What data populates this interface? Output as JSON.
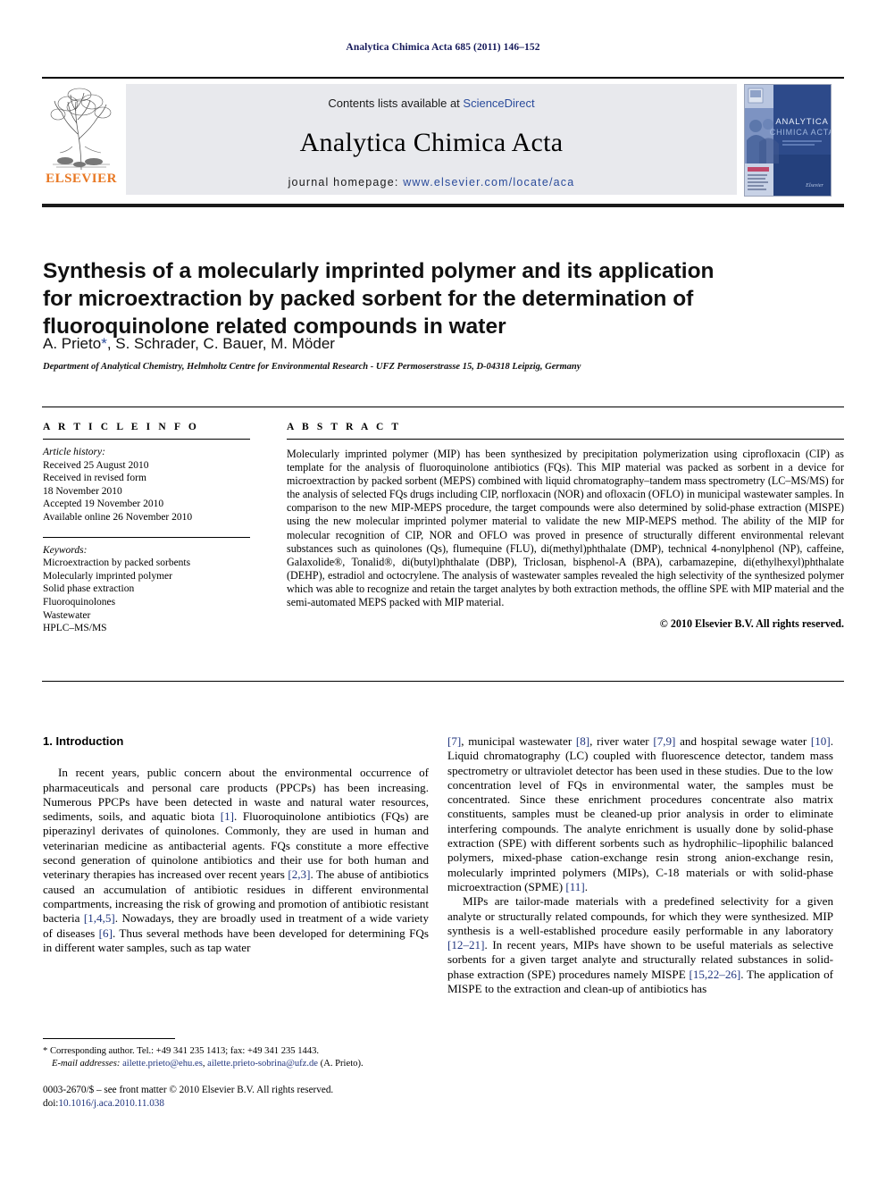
{
  "running_head": "Analytica Chimica Acta 685 (2011) 146–152",
  "masthead": {
    "contents_prefix": "Contents lists available at ",
    "sciencedirect": "ScienceDirect",
    "journal_title": "Analytica Chimica Acta",
    "homepage_prefix": "journal homepage: ",
    "homepage_url": "www.elsevier.com/locate/aca",
    "publisher": "ELSEVIER",
    "cover_title_line1": "ANALYTICA",
    "cover_title_line2": "CHIMICA ACTA",
    "link_color": "#2a4b9b",
    "publisher_color": "#e87722"
  },
  "article": {
    "title": "Synthesis of a molecularly imprinted polymer and its application for microextraction by packed sorbent for the determination of fluoroquinolone related compounds in water",
    "authors": "A. Prieto",
    "authors_rest": ", S. Schrader, C. Bauer, M. Möder",
    "corresponding_marker": "*",
    "affiliation": "Department of Analytical Chemistry, Helmholtz Centre for Environmental Research - UFZ Permoserstrasse 15, D-04318 Leipzig, Germany"
  },
  "article_info": {
    "label": "A R T I C L E   I N F O",
    "history_label": "Article history:",
    "history": [
      "Received 25 August 2010",
      "Received in revised form",
      "18 November 2010",
      "Accepted 19 November 2010",
      "Available online 26 November 2010"
    ],
    "keywords_label": "Keywords:",
    "keywords": [
      "Microextraction by packed sorbents",
      "Molecularly imprinted polymer",
      "Solid phase extraction",
      "Fluoroquinolones",
      "Wastewater",
      "HPLC–MS/MS"
    ]
  },
  "abstract": {
    "label": "A B S T R A C T",
    "text": "Molecularly imprinted polymer (MIP) has been synthesized by precipitation polymerization using ciprofloxacin (CIP) as template for the analysis of fluoroquinolone antibiotics (FQs). This MIP material was packed as sorbent in a device for microextraction by packed sorbent (MEPS) combined with liquid chromatography–tandem mass spectrometry (LC–MS/MS) for the analysis of selected FQs drugs including CIP, norfloxacin (NOR) and ofloxacin (OFLO) in municipal wastewater samples. In comparison to the new MIP-MEPS procedure, the target compounds were also determined by solid-phase extraction (MISPE) using the new molecular imprinted polymer material to validate the new MIP-MEPS method. The ability of the MIP for molecular recognition of CIP, NOR and OFLO was proved in presence of structurally different environmental relevant substances such as quinolones (Qs), flumequine (FLU), di(methyl)phthalate (DMP), technical 4-nonylphenol (NP), caffeine, Galaxolide®, Tonalid®, di(butyl)phthalate (DBP), Triclosan, bisphenol-A (BPA), carbamazepine, di(ethylhexyl)phthalate (DEHP), estradiol and octocrylene. The analysis of wastewater samples revealed the high selectivity of the synthesized polymer which was able to recognize and retain the target analytes by both extraction methods, the offline SPE with MIP material and the semi-automated MEPS packed with MIP material.",
    "copyright": "© 2010 Elsevier B.V. All rights reserved."
  },
  "introduction": {
    "heading": "1. Introduction",
    "left_para_1_a": "In recent years, public concern about the environmental occurrence of pharmaceuticals and personal care products (PPCPs) has been increasing. Numerous PPCPs have been detected in waste and natural water resources, sediments, soils, and aquatic biota ",
    "cite_1": "[1]",
    "left_para_1_b": ". Fluoroquinolone antibiotics (FQs) are piperazinyl derivates of quinolones. Commonly, they are used in human and veterinarian medicine as antibacterial agents. FQs constitute a more effective second generation of quinolone antibiotics and their use for both human and veterinary therapies has increased over recent years ",
    "cite_2_3": "[2,3]",
    "left_para_1_c": ". The abuse of antibiotics caused an accumulation of antibiotic residues in different environmental compartments, increasing the risk of growing and promotion of antibiotic resistant bacteria ",
    "cite_1_4_5": "[1,4,5]",
    "left_para_1_d": ". Nowadays, they are broadly used in treatment of a wide variety of diseases ",
    "cite_6": "[6]",
    "left_para_1_e": ". Thus several methods have been developed for determining FQs in different water samples, such as tap water ",
    "right_cite_7": "[7]",
    "right_a": ", municipal wastewater ",
    "right_cite_8": "[8]",
    "right_b": ", river water ",
    "right_cite_7_9": "[7,9]",
    "right_c": " and hospital sewage water ",
    "right_cite_10": "[10]",
    "right_d": ". Liquid chromatography (LC) coupled with fluorescence detector, tandem mass spectrometry or ultraviolet detector has been used in these studies. Due to the low concentration level of FQs in environmental water, the samples must be concentrated. Since these enrichment procedures concentrate also matrix constituents, samples must be cleaned-up prior analysis in order to eliminate interfering compounds. The analyte enrichment is usually done by solid-phase extraction (SPE) with different sorbents such as hydrophilic–lipophilic balanced polymers, mixed-phase cation-exchange resin strong anion-exchange resin, molecularly imprinted polymers (MIPs), C-18 materials or with solid-phase microextraction (SPME) ",
    "right_cite_11": "[11]",
    "right_e": ".",
    "right_para_2_a": "MIPs are tailor-made materials with a predefined selectivity for a given analyte or structurally related compounds, for which they were synthesized. MIP synthesis is a well-established procedure easily performable in any laboratory ",
    "right_cite_12_21": "[12–21]",
    "right_para_2_b": ". In recent years, MIPs have shown to be useful materials as selective sorbents for a given target analyte and structurally related substances in solid-phase extraction (SPE) procedures namely MISPE ",
    "right_cite_15_22_26": "[15,22–26]",
    "right_para_2_c": ". The application of MISPE to the extraction and clean-up of antibiotics has"
  },
  "footnote": {
    "marker": "*",
    "corresponding": " Corresponding author. Tel.: +49 341 235 1413; fax: +49 341 235 1443.",
    "email_label": "E-mail addresses:",
    "email_1": "ailette.prieto@ehu.es",
    "email_sep": ", ",
    "email_2": "ailette.prieto-sobrina@ufz.de",
    "email_suffix": " (A. Prieto)."
  },
  "footer": {
    "issn_line": "0003-2670/$ – see front matter © 2010 Elsevier B.V. All rights reserved.",
    "doi_label": "doi:",
    "doi_value": "10.1016/j.aca.2010.11.038"
  }
}
